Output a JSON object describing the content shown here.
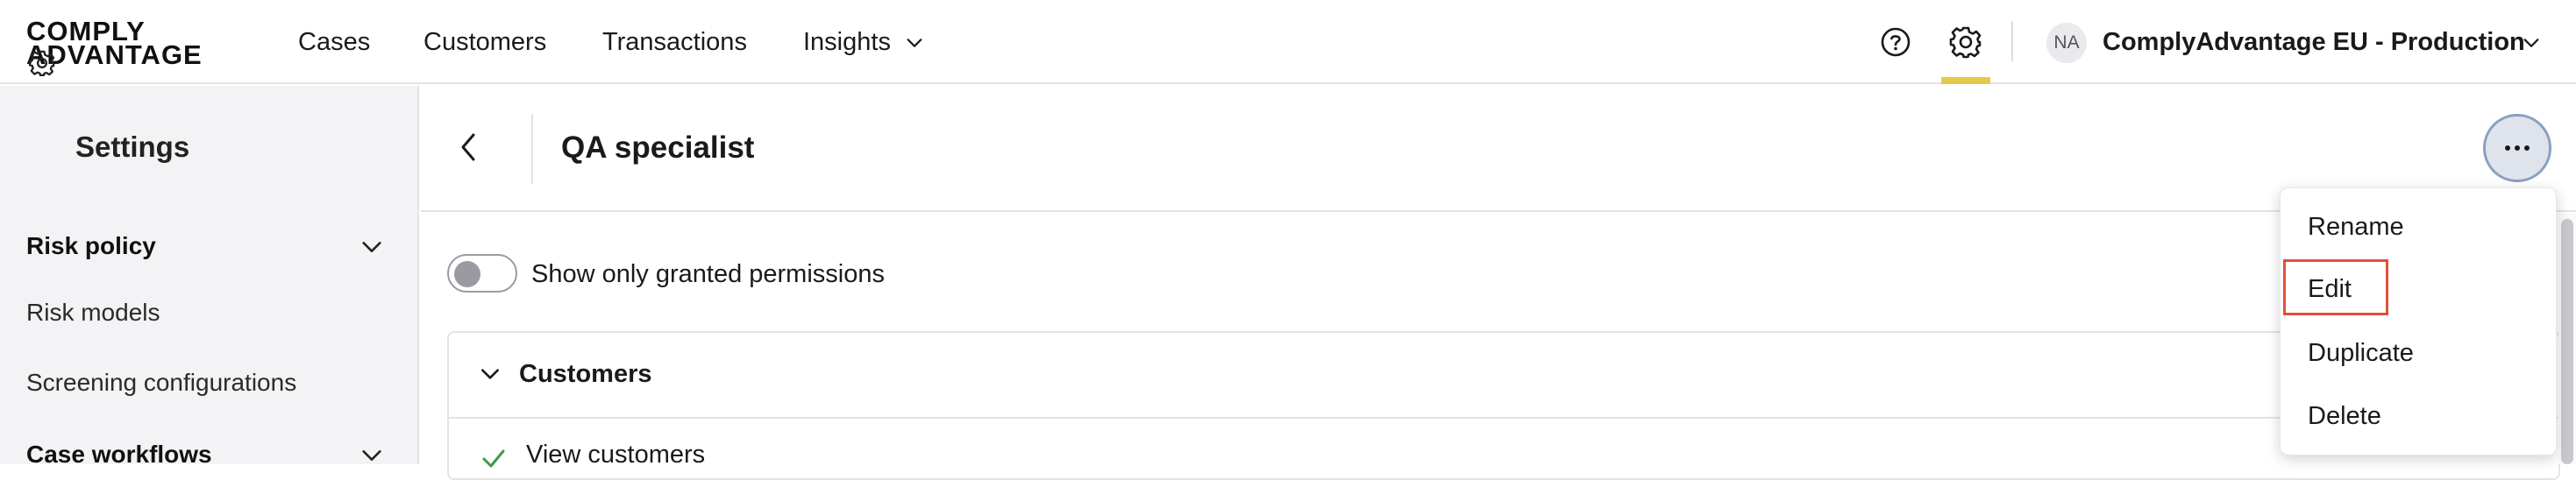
{
  "brand": {
    "logo_line1": "COMPLY",
    "logo_line2": "ADVANTAGE",
    "accent": "#e6c94a"
  },
  "nav": {
    "links": [
      {
        "label": "Cases"
      },
      {
        "label": "Customers"
      },
      {
        "label": "Transactions"
      },
      {
        "label": "Insights"
      }
    ],
    "icons": [
      "help-circle-icon",
      "gear-icon",
      "chevron-down-icon"
    ],
    "avatar_initials": "NA",
    "org_name": "ComplyAdvantage EU - Production"
  },
  "sidebar": {
    "title": "Settings",
    "sections": [
      {
        "label": "Risk policy",
        "items": [
          "Risk models",
          "Screening configurations"
        ]
      },
      {
        "label": "Case workflows"
      }
    ]
  },
  "main": {
    "title": "QA specialist",
    "toggle_label": "Show only granted permissions",
    "toggle_on": false,
    "card": {
      "title": "Customers",
      "permissions": [
        "View customers"
      ]
    }
  },
  "menu": {
    "items": [
      "Rename",
      "Edit",
      "Duplicate",
      "Delete"
    ],
    "highlight_color": "#e0503a"
  }
}
